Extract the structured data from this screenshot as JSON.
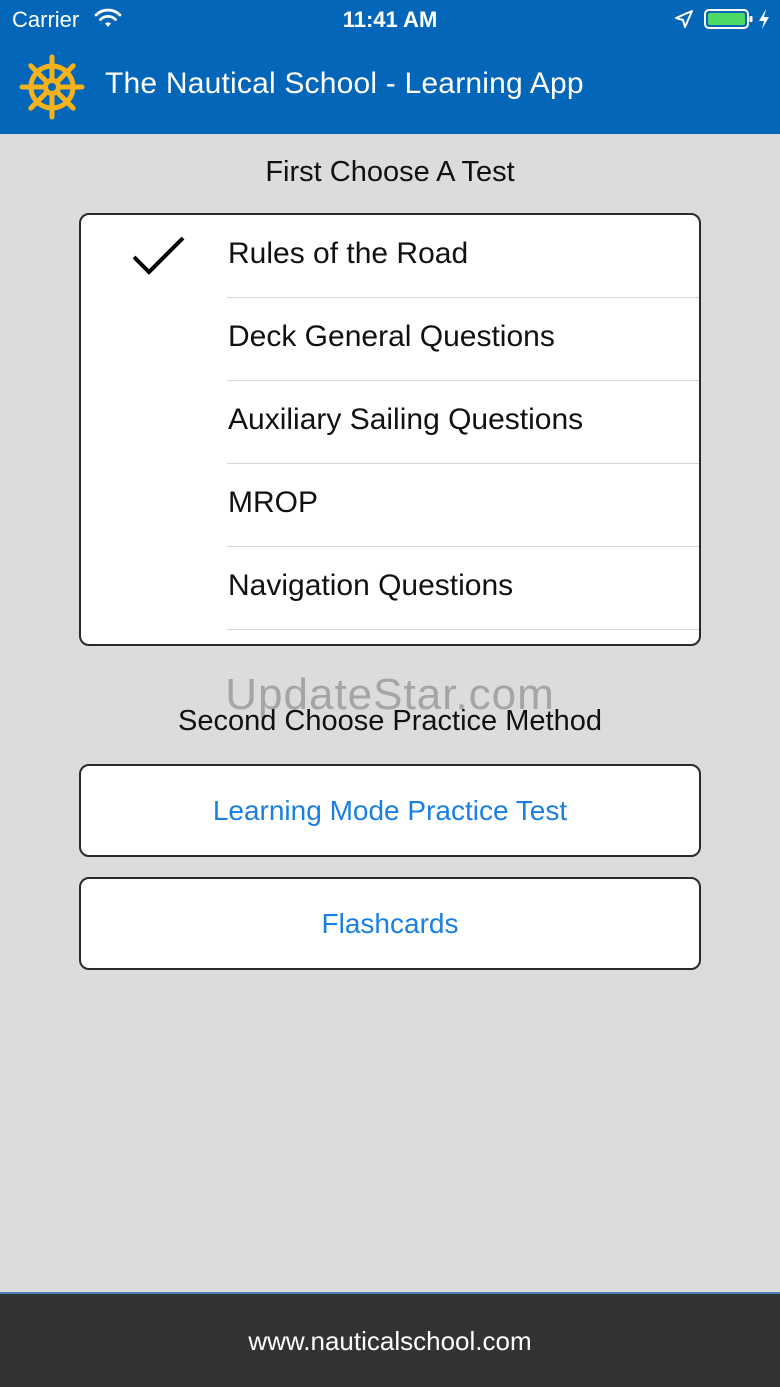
{
  "status_bar": {
    "carrier": "Carrier",
    "time": "11:41 AM",
    "icons": [
      "wifi-icon",
      "location-arrow-icon",
      "battery-icon",
      "charging-bolt-icon"
    ]
  },
  "app_bar": {
    "title": "The Nautical School - Learning App",
    "logo_icon": "ship-wheel-icon",
    "logo_color": "#f5b21b"
  },
  "first_section": {
    "title": "First Choose A Test",
    "tests": [
      {
        "label": "Rules of the Road",
        "selected": true
      },
      {
        "label": "Deck General Questions",
        "selected": false
      },
      {
        "label": "Auxiliary Sailing Questions",
        "selected": false
      },
      {
        "label": "MROP",
        "selected": false
      },
      {
        "label": "Navigation Questions",
        "selected": false
      }
    ]
  },
  "watermark": "UpdateStar.com",
  "second_section": {
    "title": "Second Choose Practice Method",
    "methods": [
      {
        "label": "Learning Mode Practice Test"
      },
      {
        "label": "Flashcards"
      }
    ]
  },
  "footer": {
    "url": "www.nauticalschool.com"
  },
  "colors": {
    "header_blue": "#0366b8",
    "background": "#dcdcdc",
    "link_blue": "#1a7fe0",
    "footer_bg": "#333333",
    "battery_green": "#4cd964"
  }
}
